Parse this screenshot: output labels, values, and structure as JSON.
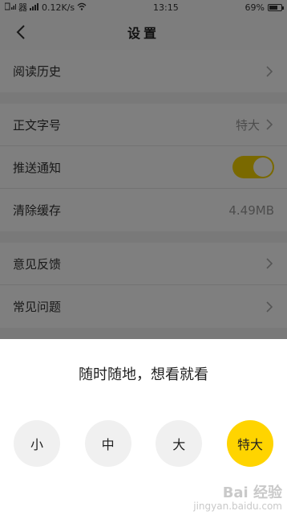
{
  "status_bar": {
    "carrier": "器",
    "net_speed": "0.12K/s",
    "time": "13:15",
    "battery_text": "69%",
    "battery_level": 0.69
  },
  "header": {
    "title": "设置"
  },
  "settings": {
    "reading_history": "阅读历史",
    "font_size_label": "正文字号",
    "font_size_value": "特大",
    "push_label": "推送通知",
    "push_enabled": true,
    "cache_label": "清除缓存",
    "cache_value": "4.49MB",
    "feedback_label": "意见反馈",
    "faq_label": "常见问题"
  },
  "sheet": {
    "title": "随时随地，想看就看",
    "options": [
      "小",
      "中",
      "大",
      "特大"
    ],
    "selected": "特大"
  },
  "colors": {
    "accent": "#ffd400",
    "toggle_on": "#f5d300"
  },
  "watermark": {
    "main": "Bai 经验",
    "sub": "jingyan.baidu.com"
  }
}
